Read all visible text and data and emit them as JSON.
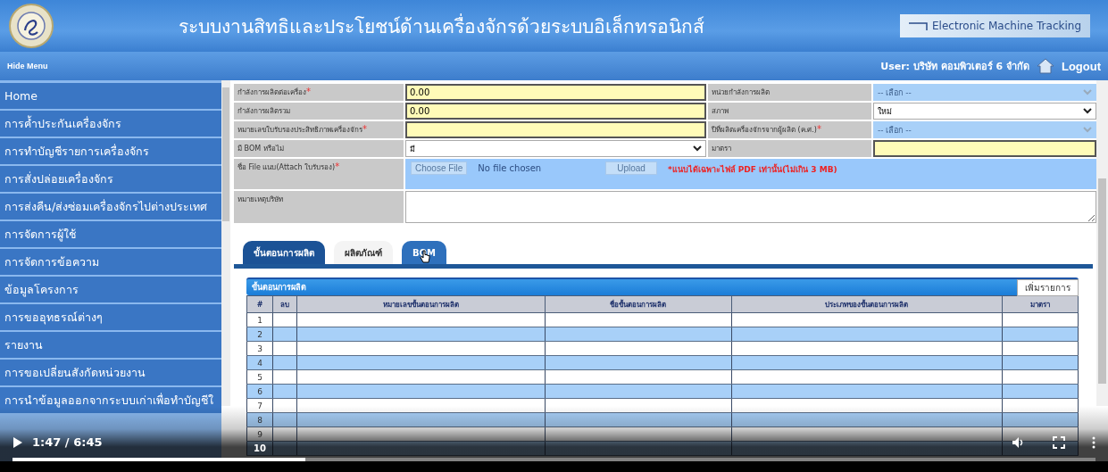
{
  "header": {
    "title": "ระบบงานสิทธิและประโยชน์ด้านเครื่องจักรด้วยระบบอิเล็กทรอนิกส์",
    "badge": "Electronic Machine Tracking"
  },
  "menubar": {
    "hide_menu": "Hide Menu",
    "user": "User: บริษัท คอมพิวเตอร์ 6 จำกัด",
    "logout": "Logout"
  },
  "sidebar": {
    "items": [
      "Home",
      "การค้ำประกันเครื่องจักร",
      "การทำบัญชีรายการเครื่องจักร",
      "การสั่งปล่อยเครื่องจักร",
      "การส่งคืน/ส่งซ่อมเครื่องจักรไปต่างประเทศ",
      "การจัดการผู้ใช้",
      "การจัดการข้อความ",
      "ข้อมูลโครงการ",
      "การขออุทธรณ์ต่างๆ",
      "รายงาน",
      "การขอเปลี่ยนสังกัดหน่วยงาน",
      "การนำข้อมูลออกจากระบบเก่าเพื่อทำบัญชีใ"
    ]
  },
  "form": {
    "rows": [
      {
        "kind": "pair",
        "left": {
          "label": "กำลังการผลิตต่อเครื่อง",
          "mark": "*",
          "kind": "text",
          "value": "0.00"
        },
        "right": {
          "label": "หน่วยกำลังการผลิต",
          "kind": "select",
          "value": "-- เลือก --",
          "disabled": true
        }
      },
      {
        "kind": "pair",
        "left": {
          "label": "กำลังการผลิตรวม",
          "kind": "text",
          "value": "0.00"
        },
        "right": {
          "label": "สภาพ",
          "kind": "select",
          "value": "ใหม่",
          "disabled": false
        }
      },
      {
        "kind": "pair",
        "left": {
          "label": "หมายเลขใบรับรองประสิทธิภาพเครื่องจักร",
          "mark": "*",
          "kind": "text"
        },
        "right": {
          "label": "ปีที่ผลิตเครื่องจักรจากผู้ผลิต (ค.ศ.)",
          "mark": "*",
          "kind": "select",
          "value": "-- เลือก --",
          "disabled": true
        }
      },
      {
        "kind": "pair",
        "left": {
          "label": "มี BOM หรือไม่",
          "kind": "select",
          "value": "มี",
          "disabled": false
        },
        "right": {
          "label": "มาตรา",
          "kind": "text"
        }
      },
      {
        "kind": "file",
        "label": "ชื่อ File แนบ(Attach ใบรับรอง)",
        "mark": "*",
        "choose": "Choose File",
        "status": "No file chosen",
        "upload": "Upload",
        "note": "*แนบได้เฉพาะไฟล์ PDF เท่านั้น(ไม่เกิน 3 MB)"
      },
      {
        "kind": "textarea",
        "label": "หมายเหตุบริษัท"
      }
    ]
  },
  "tabs": [
    {
      "label": "ขั้นตอนการผลิต",
      "selected": true,
      "hovered": false
    },
    {
      "label": "ผลิตภัณฑ์",
      "selected": false,
      "hovered": false
    },
    {
      "label": "BOM",
      "selected": false,
      "hovered": true
    }
  ],
  "panel": {
    "title": "ขั้นตอนการผลิต",
    "add_button": "เพิ่มรายการ",
    "columns": [
      "#",
      "ลบ",
      "หมายเลขขั้นตอนการผลิต",
      "ชื่อขั้นตอนการผลิต",
      "ประเภทของขั้นตอนการผลิต",
      "มาตรา"
    ],
    "rows": [
      "1",
      "2",
      "3",
      "4",
      "5",
      "6",
      "7",
      "8",
      "9",
      "10"
    ]
  },
  "video": {
    "time": "1:47 / 6:45",
    "level": 0.27
  }
}
